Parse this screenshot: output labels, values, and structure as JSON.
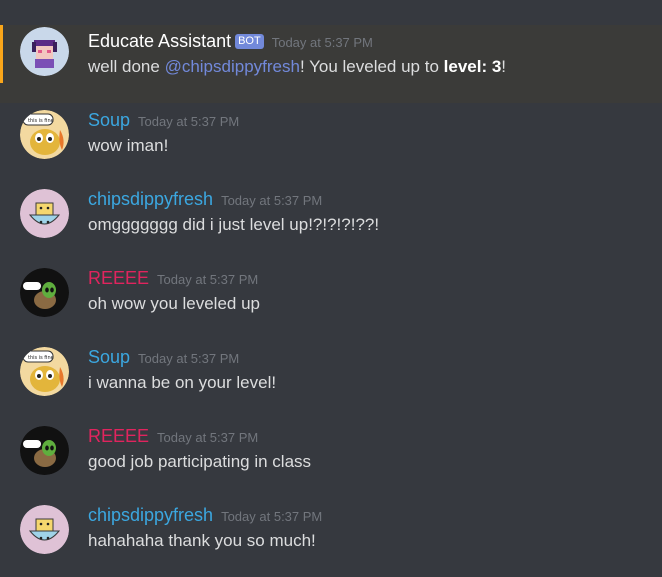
{
  "colors": {
    "background": "#36393f",
    "highlight_background": "#3b3b39",
    "highlight_bar": "#faa61a",
    "text": "#dcddde",
    "timestamp": "#72767d",
    "mention": "#7289da",
    "bot_badge": "#7289da",
    "user_blue": "#3ba7e0",
    "user_red": "#e0245e",
    "user_white": "#ffffff"
  },
  "messages": [
    {
      "author": "Educate Assistant",
      "author_color": "#ffffff",
      "bot_badge": "BOT",
      "timestamp": "Today at 5:37 PM",
      "avatar_icon": "bot-avatar-icon",
      "highlighted": true,
      "content": {
        "before_mention": "well done ",
        "mention": "@chipsdippyfresh",
        "middle": "! You leveled up to ",
        "bold": "level: 3",
        "after": "!"
      }
    },
    {
      "author": "Soup",
      "author_color": "#3ba7e0",
      "timestamp": "Today at 5:37 PM",
      "avatar_icon": "soup-avatar-icon",
      "text": "wow iman!"
    },
    {
      "author": "chipsdippyfresh",
      "author_color": "#3ba7e0",
      "timestamp": "Today at 5:37 PM",
      "avatar_icon": "chips-avatar-icon",
      "text": "omggggggg did i just level up!?!?!?!??!"
    },
    {
      "author": "REEEE",
      "author_color": "#e0245e",
      "timestamp": "Today at 5:37 PM",
      "avatar_icon": "reeee-avatar-icon",
      "text": "oh wow you leveled up"
    },
    {
      "author": "Soup",
      "author_color": "#3ba7e0",
      "timestamp": "Today at 5:37 PM",
      "avatar_icon": "soup-avatar-icon",
      "text": "i wanna be on your level!"
    },
    {
      "author": "REEEE",
      "author_color": "#e0245e",
      "timestamp": "Today at 5:37 PM",
      "avatar_icon": "reeee-avatar-icon",
      "text": "good job participating in class"
    },
    {
      "author": "chipsdippyfresh",
      "author_color": "#3ba7e0",
      "timestamp": "Today at 5:37 PM",
      "avatar_icon": "chips-avatar-icon",
      "text": "hahahaha thank you so much!"
    }
  ]
}
